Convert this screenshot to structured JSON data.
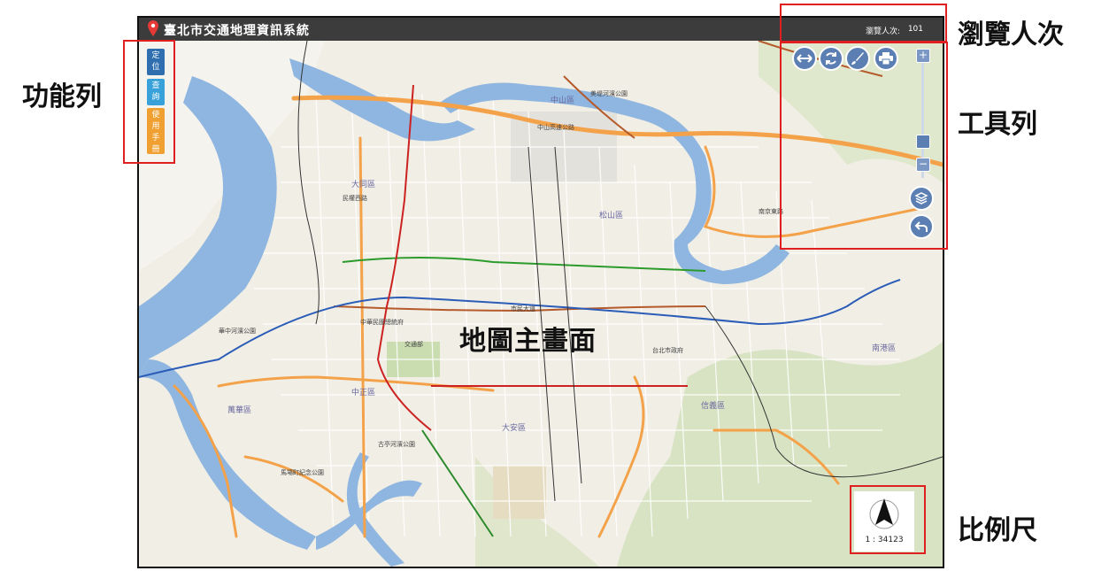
{
  "app": {
    "title": "臺北市交通地理資訊系統",
    "visitor_label": "瀏覽人次:",
    "visitor_count": "101"
  },
  "function_bar": {
    "locate": "定位",
    "query": "查詢",
    "manual": "使用手冊"
  },
  "tools": {
    "icons": [
      "measure-icon",
      "refresh-icon",
      "draw-brush-icon",
      "print-icon"
    ],
    "zoom_in": "+",
    "zoom_out": "−"
  },
  "map": {
    "center_label": "地圖主畫面",
    "place_labels": [
      "中山區",
      "大同區",
      "松山區",
      "萬華區",
      "大安區",
      "信義區",
      "南港區",
      "中正區",
      "美堤河濱公園",
      "中山高速公路",
      "民權西路",
      "南京東路",
      "市民大道",
      "中華民國總統府",
      "交通部",
      "台北市政府",
      "古亭河濱公園",
      "馬場町紀念公園",
      "華中河濱公園"
    ]
  },
  "scale": {
    "text": "1 : 34123"
  },
  "annotations": {
    "visitor": "瀏覽人次",
    "function_bar": "功能列",
    "toolbar": "工具列",
    "scale": "比例尺"
  },
  "colors": {
    "titlebar": "#3c3c3c",
    "locate_btn": "#2f6fb0",
    "query_btn": "#39a1d9",
    "manual_btn": "#f0a030",
    "tool_btn": "#5b7fb3",
    "annotation_red": "#e02020"
  }
}
